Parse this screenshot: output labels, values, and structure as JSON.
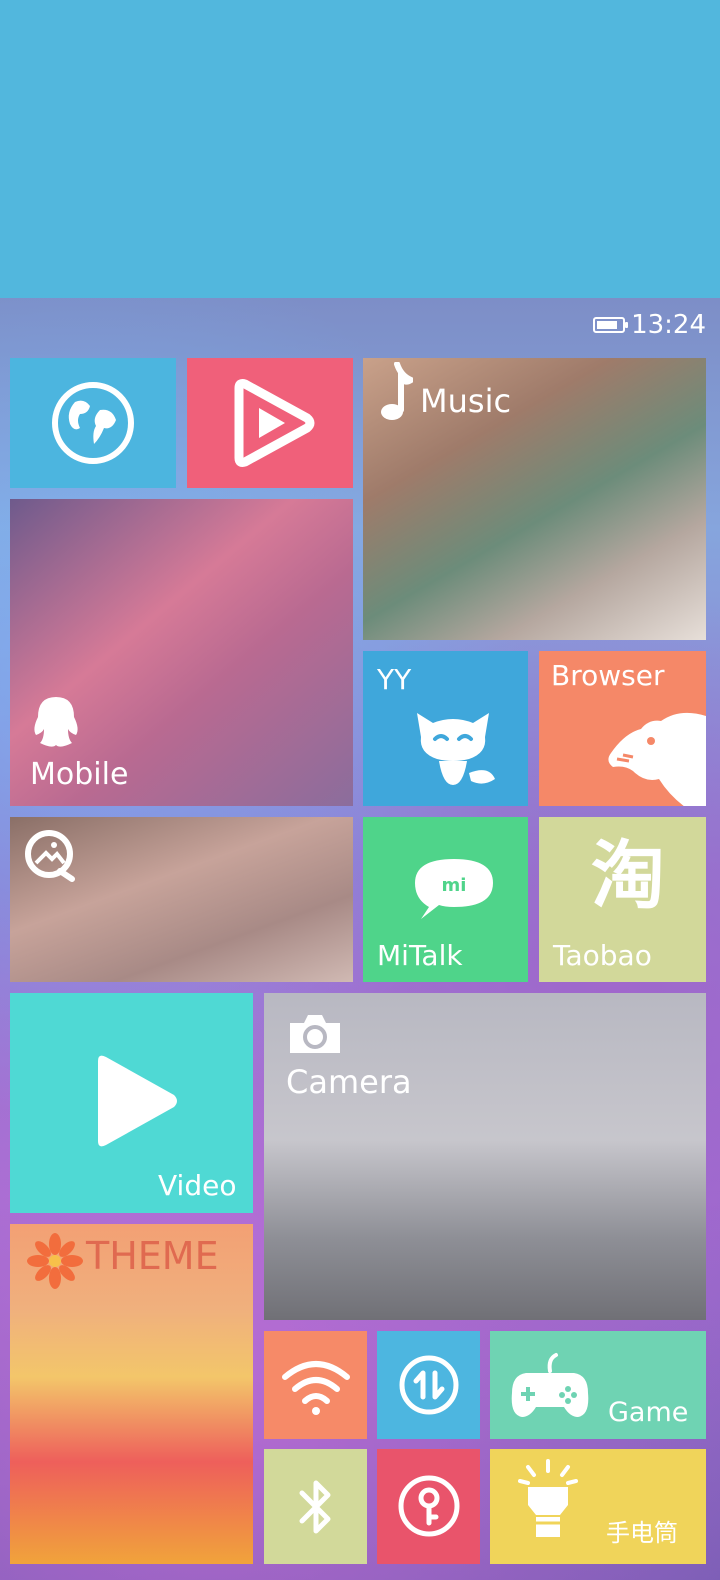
{
  "status_bar": {
    "time": "13:24",
    "battery_level": 0.85
  },
  "tiles": {
    "music": {
      "label": "Music"
    },
    "mobile": {
      "label": "Mobile"
    },
    "yy": {
      "label": "YY"
    },
    "browser": {
      "label": "Browser"
    },
    "mitalk": {
      "label": "MiTalk",
      "badge": "mi"
    },
    "taobao": {
      "label": "Taobao",
      "glyph": "淘"
    },
    "video": {
      "label": "Video"
    },
    "camera": {
      "label": "Camera"
    },
    "theme": {
      "label": "THEME"
    },
    "game": {
      "label": "Game"
    },
    "flashlight": {
      "label": "手电筒"
    }
  },
  "icons": {
    "globe": "globe-icon",
    "video_player": "play-icon",
    "music": "music-note-icon",
    "mobile": "qq-penguin-icon",
    "yy": "yy-mascot-icon",
    "browser": "bear-icon",
    "gallery": "gallery-icon",
    "mitalk": "chat-bubble-icon",
    "video": "play-icon",
    "camera": "camera-icon",
    "theme": "flower-icon",
    "wifi": "wifi-icon",
    "sync": "sync-icon",
    "game": "gamepad-icon",
    "bluetooth": "bluetooth-icon",
    "lock": "key-lock-icon",
    "flashlight": "flashlight-icon"
  },
  "colors": {
    "top_band": "#52b7dd",
    "globe_tile": "#4cb5df",
    "video_red_tile": "#f0607a",
    "yy_tile": "#3fa7db",
    "browser_tile": "#f58868",
    "mitalk_tile": "#4fd48a",
    "taobao_tile": "#d2d89a",
    "video_tile": "#4fd9d4",
    "wifi_tile": "#f68a68",
    "sync_tile": "#4db6e0",
    "game_tile": "#6fd3b3",
    "bluetooth_tile": "#d2d99a",
    "lock_tile": "#e9546b",
    "flashlight_tile": "#f0d45a"
  }
}
